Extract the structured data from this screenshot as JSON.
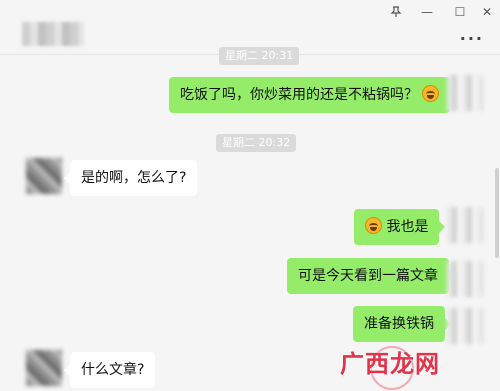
{
  "window": {
    "pin_icon": "pin-icon",
    "minimize_glyph": "—",
    "maximize_glyph": "☐",
    "close_glyph": "✕",
    "more_glyph": "···"
  },
  "timestamps": {
    "first_partial": "星期二 20:31",
    "second": "星期二 20:32"
  },
  "messages": [
    {
      "from": "me",
      "text": "吃饭了吗，你炒菜用的还是不粘锅吗？",
      "emoji_after": true
    },
    {
      "from": "other",
      "text": "是的啊，怎么了?"
    },
    {
      "from": "me",
      "text": "我也是",
      "emoji_before": true
    },
    {
      "from": "me",
      "text": "可是今天看到一篇文章"
    },
    {
      "from": "me",
      "text": "准备换铁锅"
    },
    {
      "from": "other",
      "text": "什么文章?"
    }
  ],
  "watermark": {
    "text": "广西龙网"
  },
  "colors": {
    "me_bubble": "#95ec69",
    "other_bubble": "#ffffff",
    "background": "#f5f5f5"
  }
}
